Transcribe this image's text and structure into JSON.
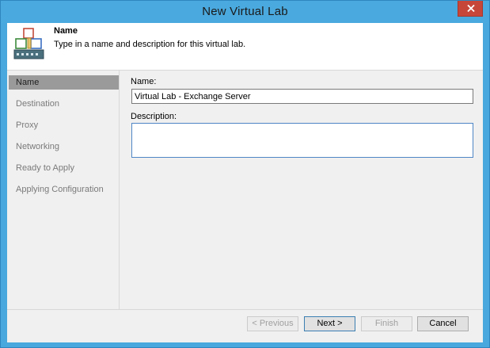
{
  "window": {
    "title": "New Virtual Lab",
    "accent_color": "#49a8dd",
    "close_color": "#c7463a"
  },
  "header": {
    "icon": "virtual-lab-icon",
    "title": "Name",
    "subtitle": "Type in a name and description for this virtual lab."
  },
  "nav": {
    "items": [
      {
        "label": "Name",
        "active": true
      },
      {
        "label": "Destination",
        "active": false
      },
      {
        "label": "Proxy",
        "active": false
      },
      {
        "label": "Networking",
        "active": false
      },
      {
        "label": "Ready to Apply",
        "active": false
      },
      {
        "label": "Applying Configuration",
        "active": false
      }
    ]
  },
  "form": {
    "name_label": "Name:",
    "name_value": "Virtual Lab - Exchange Server",
    "description_label": "Description:",
    "description_value": ""
  },
  "footer": {
    "previous_label": "< Previous",
    "next_label": "Next >",
    "finish_label": "Finish",
    "cancel_label": "Cancel"
  }
}
